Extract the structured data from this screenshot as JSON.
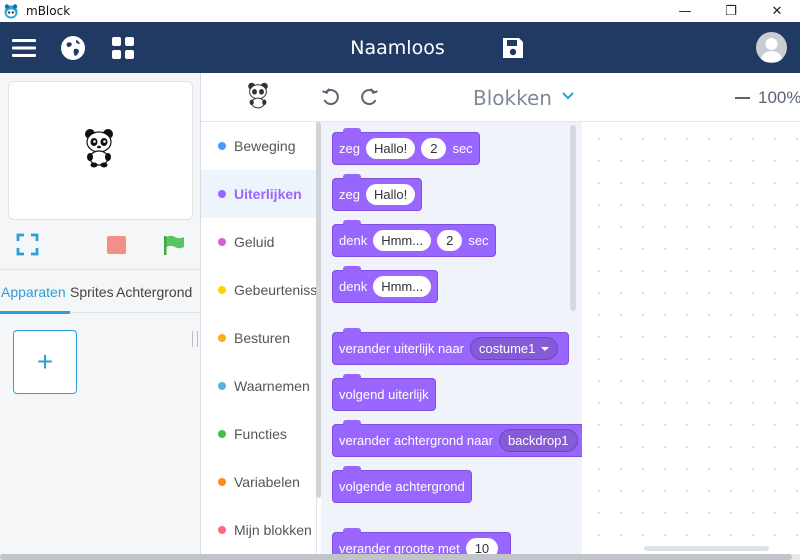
{
  "window": {
    "app_title": "mBlock",
    "minimize": "—",
    "maximize": "❐",
    "close": "✕"
  },
  "header": {
    "project_title": "Naamloos",
    "icons": [
      "menu-icon",
      "globe-icon",
      "apps-icon",
      "save-icon",
      "avatar"
    ]
  },
  "left_panel": {
    "tabs": [
      {
        "label": "Apparaten",
        "active": true
      },
      {
        "label": "Sprites",
        "active": false
      },
      {
        "label": "Achtergrond",
        "active": false
      }
    ],
    "add_label": "+"
  },
  "toolbar": {
    "title": "Blokken",
    "zoom": "100%"
  },
  "categories": [
    {
      "label": "Beweging",
      "color": "#4c97ff",
      "active": false
    },
    {
      "label": "Uiterlijken",
      "color": "#9966ff",
      "active": true
    },
    {
      "label": "Geluid",
      "color": "#cf63cf",
      "active": false
    },
    {
      "label": "Gebeurtenissen",
      "color": "#ffd500",
      "active": false
    },
    {
      "label": "Besturen",
      "color": "#ffab19",
      "active": false
    },
    {
      "label": "Waarnemen",
      "color": "#5cb1d6",
      "active": false
    },
    {
      "label": "Functies",
      "color": "#40bf4a",
      "active": false
    },
    {
      "label": "Variabelen",
      "color": "#ff8c1a",
      "active": false
    },
    {
      "label": "Mijn blokken",
      "color": "#ff6680",
      "active": false
    }
  ],
  "blocks": [
    {
      "text": "zeg",
      "input": "Hallo!",
      "num": "2",
      "suffix": "sec"
    },
    {
      "text": "zeg",
      "input": "Hallo!"
    },
    {
      "text": "denk",
      "input": "Hmm...",
      "num": "2",
      "suffix": "sec"
    },
    {
      "text": "denk",
      "input": "Hmm..."
    },
    {
      "text": "verander uiterlijk naar",
      "dropdown": "costume1"
    },
    {
      "text": "volgend uiterlijk"
    },
    {
      "text": "verander achtergrond naar",
      "dropdown": "backdrop1"
    },
    {
      "text": "volgende achtergrond"
    },
    {
      "text": "verander grootte met",
      "num": "10"
    }
  ],
  "colors": {
    "header_bg": "#213a63",
    "looks_block": "#9966ff",
    "accent": "#2a9fd8"
  }
}
